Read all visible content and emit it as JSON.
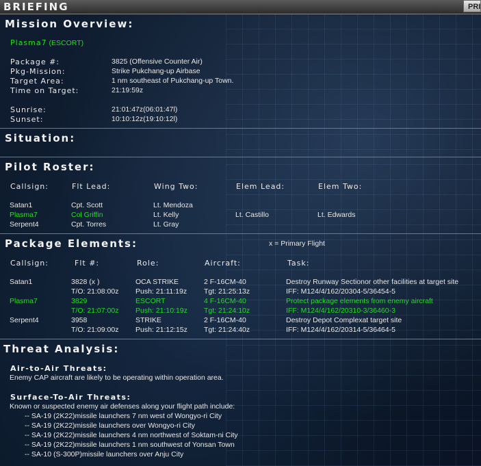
{
  "window": {
    "title": "BRIEFING",
    "print_label": "PRI"
  },
  "overview": {
    "heading": "Mission Overview:",
    "flight": "Plasma7",
    "flight_role": "(ESCORT)",
    "package_label": "Package #:",
    "package_value": "3825 (Offensive Counter Air)",
    "pkg_mission_label": "Pkg-Mission:",
    "pkg_mission_value": "Strike Pukchang-up Airbase",
    "target_area_label": "Target Area:",
    "target_area_value": "1 nm southeast of Pukchang-up Town.",
    "tot_label": "Time on Target:",
    "tot_value": "21:19:59z",
    "sunrise_label": "Sunrise:",
    "sunrise_value": "21:01:47z(06:01:47l)",
    "sunset_label": "Sunset:",
    "sunset_value": "10:10:12z(19:10:12l)"
  },
  "situation": {
    "heading": "Situation:"
  },
  "roster": {
    "heading": "Pilot Roster:",
    "columns": [
      "Callsign:",
      "Flt Lead:",
      "Wing Two:",
      "Elem Lead:",
      "Elem Two:"
    ],
    "rows": [
      {
        "callsign": "Satan1",
        "lead": "Cpt. Scott",
        "wing": "Lt. Mendoza",
        "elem_lead": "",
        "elem_two": "",
        "highlight": false
      },
      {
        "callsign": "Plasma7",
        "lead": "Col Griffin",
        "wing": "Lt. Kelly",
        "elem_lead": "Lt. Castillo",
        "elem_two": "Lt. Edwards",
        "highlight": true
      },
      {
        "callsign": "Serpent4",
        "lead": "Cpt. Torres",
        "wing": "Lt. Gray",
        "elem_lead": "",
        "elem_two": "",
        "highlight": false
      }
    ]
  },
  "package": {
    "heading": "Package Elements:",
    "legend": "x  = Primary Flight",
    "columns": [
      "Callsign:",
      "Flt #:",
      "Role:",
      "Aircraft:",
      "Task:"
    ],
    "rows": [
      {
        "callsign": "Satan1",
        "flt": "3828 (x )",
        "to": "T/O: 21:08:00z",
        "role": "OCA STRIKE",
        "push": "Push: 21:11:19z",
        "aircraft": "2 F-16CM-40",
        "tgt": "Tgt: 21:25:13z",
        "task": "Destroy Runway Sectionor other facilities at target site",
        "iff": "IFF: M124/4/162/20304-5/36454-5",
        "highlight": false
      },
      {
        "callsign": "Plasma7",
        "flt": "3829",
        "to": "T/O: 21:07:00z",
        "role": "ESCORT",
        "push": "Push: 21:10:19z",
        "aircraft": "4 F-16CM-40",
        "tgt": "Tgt: 21:24:10z",
        "task": "Protect package elements from enemy aircraft",
        "iff": "IFF: M124/4/162/20310-3/36460-3",
        "highlight": true
      },
      {
        "callsign": "Serpent4",
        "flt": "3958",
        "to": "T/O: 21:09:00z",
        "role": "STRIKE",
        "push": "Push: 21:12:15z",
        "aircraft": "2 F-16CM-40",
        "tgt": "Tgt: 21:24:40z",
        "task": "Destroy Depot Complexat target site",
        "iff": "IFF: M124/4/162/20314-5/36464-5",
        "highlight": false
      }
    ]
  },
  "threats": {
    "heading": "Threat Analysis:",
    "air_heading": "Air-to-Air Threats:",
    "air_text": "Enemy CAP aircraft are likely to be operating within operation area.",
    "sam_heading": "Surface-To-Air Threats:",
    "sam_intro": "Known or suspected enemy air defenses along your flight path include:",
    "sam_list": [
      "-- SA-19 (2K22)missile launchers 7 nm west of Wongyo-ri City",
      "-- SA-19 (2K22)missile launchers over Wongyo-ri City",
      "-- SA-19 (2K22)missile launchers 4 nm northwest of Soktam-ni City",
      "-- SA-19 (2K22)missile launchers 1 nm southwest of Yonsan Town",
      "-- SA-10 (S-300P)missile launchers over Anju City"
    ]
  },
  "colors": {
    "highlight": "#22dd22",
    "divider": "#3a86c8",
    "background": "#0a1628"
  }
}
